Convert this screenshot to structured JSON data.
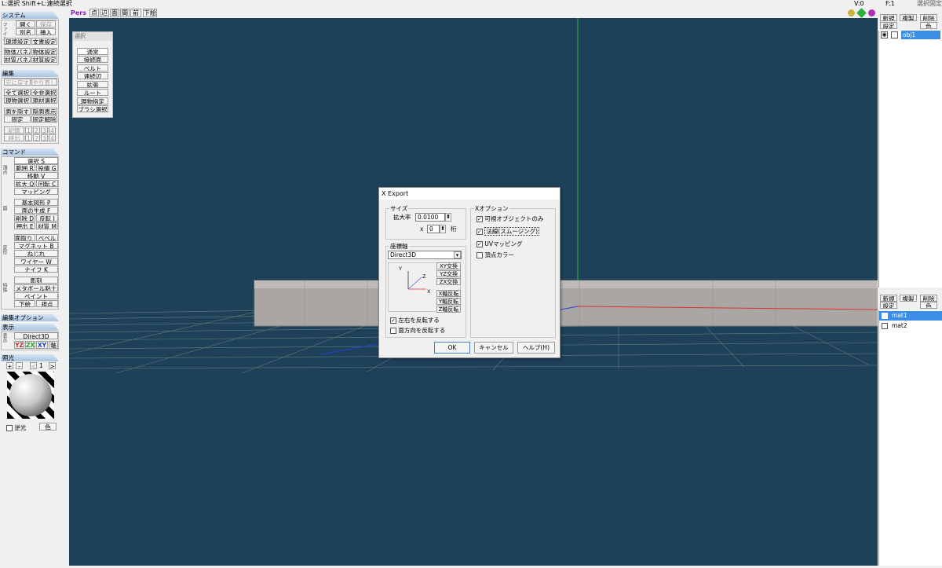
{
  "status_bar": {
    "left": "L:選択  Shift+L:連続選択",
    "v": "V:0",
    "f": "F:1",
    "right": "選択固定"
  },
  "view_toolbar": {
    "pers": "Pers",
    "buttons": [
      "点",
      "辺",
      "面",
      "間",
      "前",
      "下絵"
    ]
  },
  "left_panel": {
    "system": {
      "title": "システム",
      "side": "ファイル",
      "buttons": [
        "開く",
        "保存",
        "別名",
        "挿入",
        "環境設定",
        "文書設定",
        "物体パネル",
        "物体設定",
        "材質パネル",
        "材質設定"
      ]
    },
    "edit": {
      "title": "編集",
      "buttons": [
        "元に戻す",
        "やり直し",
        "全て選択",
        "全非選択",
        "現物選択",
        "現材選択",
        "面を隠す",
        "隠面表示",
        "固定",
        "固定解除"
      ],
      "memory": "記憶",
      "recall": "呼出",
      "slots": [
        "1",
        "2",
        "3",
        "4"
      ]
    },
    "command": {
      "title": "コマンド",
      "side1": "頂点",
      "side2": "面",
      "side3": "変形",
      "side4": "特殊",
      "buttons": [
        "選択 S",
        "範囲 R",
        "投縄 G",
        "移動 V",
        "拡大 Q",
        "回転 C",
        "マッピング",
        "基本図形 P",
        "面の生成 F",
        "削除 D",
        "反転 I",
        "押出 E",
        "材質 M",
        "面取り H",
        "ベベル",
        "マグネット B",
        "ねじれ",
        "ワイヤー W",
        "ナイフ K",
        "彫刻",
        "メタボール粘土",
        "ペイント",
        "下絵",
        "視点"
      ]
    },
    "edit_option": {
      "title": "編集オプション"
    },
    "display": {
      "title": "表示",
      "mode": "Direct3D",
      "side": "表示",
      "axes": [
        "YZ",
        "ZX",
        "XY",
        "軸"
      ]
    },
    "light": {
      "title": "照光",
      "plus": "+",
      "minus": "-",
      "prev": "<",
      "num": "1",
      "next": ">",
      "backlight": "逆光",
      "color": "色"
    }
  },
  "select_popup": {
    "title": "選択",
    "items": [
      "通常",
      "接続面",
      "ベルト",
      "連続辺",
      "拡張",
      "ルート",
      "現物指定",
      "ブラシ選択"
    ]
  },
  "dialog": {
    "title": "X Export",
    "size_group": "サイズ",
    "scale_label": "拡大率",
    "scale_value": "0.0100",
    "x_label": "x",
    "x_value": "0",
    "digits": "桁",
    "coord_group": "座標軸",
    "coord_value": "Direct3D",
    "axis_y": "Y",
    "axis_z": "Z",
    "axis_x": "X",
    "swap_buttons": [
      "XY交換",
      "YZ交換",
      "ZX交換"
    ],
    "flip_buttons": [
      "X軸反転",
      "Y軸反転",
      "Z軸反転"
    ],
    "flip_lr": "左右を反転する",
    "flip_face": "面方向を反転する",
    "x_option_group": "Xオプション",
    "options": [
      "可視オブジェクトのみ",
      "法線(スムージング)",
      "UVマッピング",
      "頂点カラー"
    ],
    "ok": "OK",
    "cancel": "キャンセル",
    "help": "ヘルプ(H)"
  },
  "right_panel": {
    "objects": {
      "new": "新規",
      "dup": "複製",
      "del": "削除",
      "settings": "設定",
      "color": "色",
      "items": [
        "obj1"
      ]
    },
    "materials": {
      "new": "新規",
      "dup": "複製",
      "del": "削除",
      "settings": "設定",
      "color": "色",
      "items": [
        "mat1",
        "mat2"
      ]
    }
  },
  "colors": {
    "viewport": "#1f4059",
    "selection": "#3a8ee6",
    "grid": "#6a8e88"
  }
}
